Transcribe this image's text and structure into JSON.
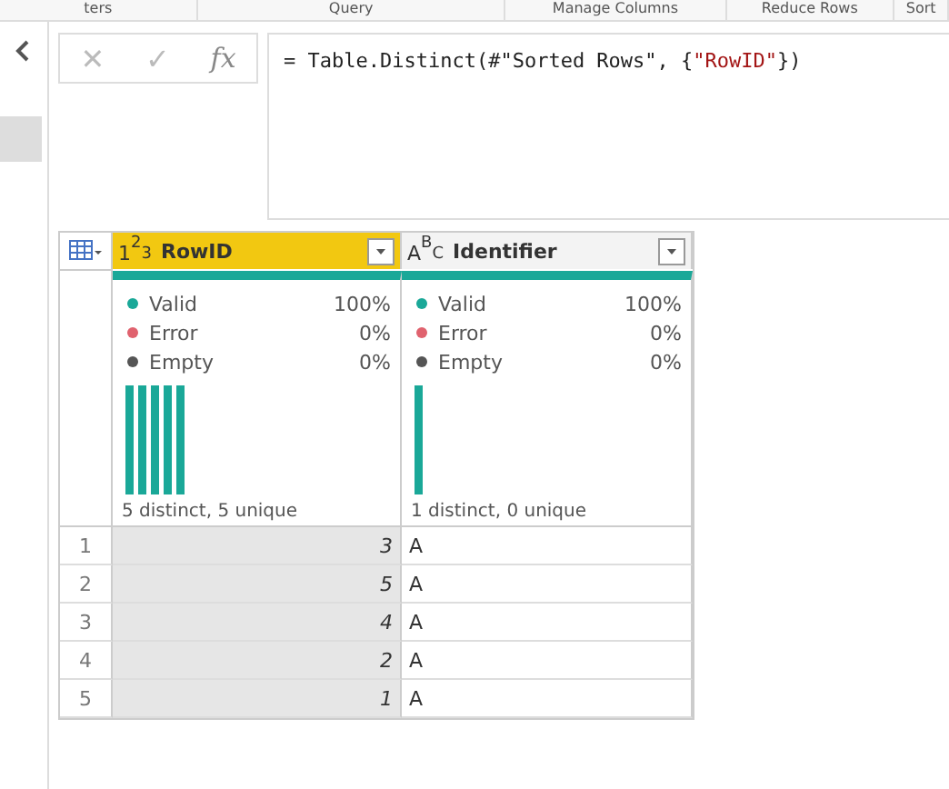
{
  "ribbon": {
    "groups": [
      "ters",
      "Query",
      "Manage Columns",
      "Reduce Rows",
      "Sort"
    ]
  },
  "formula_bar": {
    "cancel": "✕",
    "confirm": "✓",
    "fx": "fx",
    "formula": "= Table.Distinct(#\"Sorted Rows\", {",
    "formula_string": "\"RowID\"",
    "formula_end": "})"
  },
  "table": {
    "columns": [
      {
        "name": "RowID",
        "kind": "number",
        "type_glyphs": [
          "1",
          "2",
          "3"
        ],
        "selected": true,
        "stats": [
          {
            "label": "Valid",
            "value": "100%",
            "color": "#1aa898"
          },
          {
            "label": "Error",
            "value": "0%",
            "color": "#e0626e"
          },
          {
            "label": "Empty",
            "value": "0%",
            "color": "#555555"
          }
        ],
        "summary": "5 distinct, 5 unique"
      },
      {
        "name": "Identifier",
        "kind": "text",
        "type_glyphs": [
          "A",
          "B",
          "C"
        ],
        "selected": false,
        "stats": [
          {
            "label": "Valid",
            "value": "100%",
            "color": "#1aa898"
          },
          {
            "label": "Error",
            "value": "0%",
            "color": "#e0626e"
          },
          {
            "label": "Empty",
            "value": "0%",
            "color": "#555555"
          }
        ],
        "summary": "1 distinct, 0 unique"
      }
    ],
    "rows": [
      {
        "number": "1",
        "cells": [
          "3",
          "A"
        ]
      },
      {
        "number": "2",
        "cells": [
          "5",
          "A"
        ]
      },
      {
        "number": "3",
        "cells": [
          "4",
          "A"
        ]
      },
      {
        "number": "4",
        "cells": [
          "2",
          "A"
        ]
      },
      {
        "number": "5",
        "cells": [
          "1",
          "A"
        ]
      }
    ]
  }
}
